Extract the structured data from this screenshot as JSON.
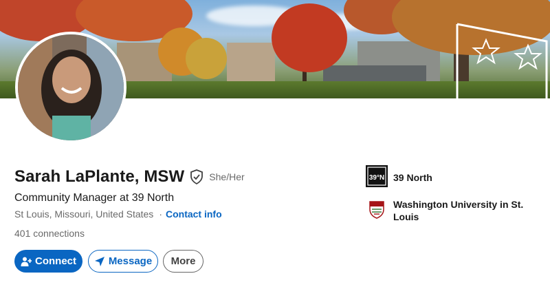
{
  "profile": {
    "name": "Sarah LaPlante, MSW",
    "pronouns": "She/Her",
    "headline": "Community Manager at 39 North",
    "location": "St Louis, Missouri, United States",
    "separator": "·",
    "contact_info": "Contact info",
    "connections": "401 connections"
  },
  "actions": {
    "connect": "Connect",
    "message": "Message",
    "more": "More"
  },
  "organizations": [
    {
      "name": "39 North",
      "logo_text": "39°N",
      "icon": "39-north-logo"
    },
    {
      "name": "Washington University in St. Louis",
      "icon": "washu-shield-logo"
    }
  ],
  "colors": {
    "brand_blue": "#0a66c2",
    "text_primary": "#000000e6",
    "text_secondary": "#00000099"
  }
}
